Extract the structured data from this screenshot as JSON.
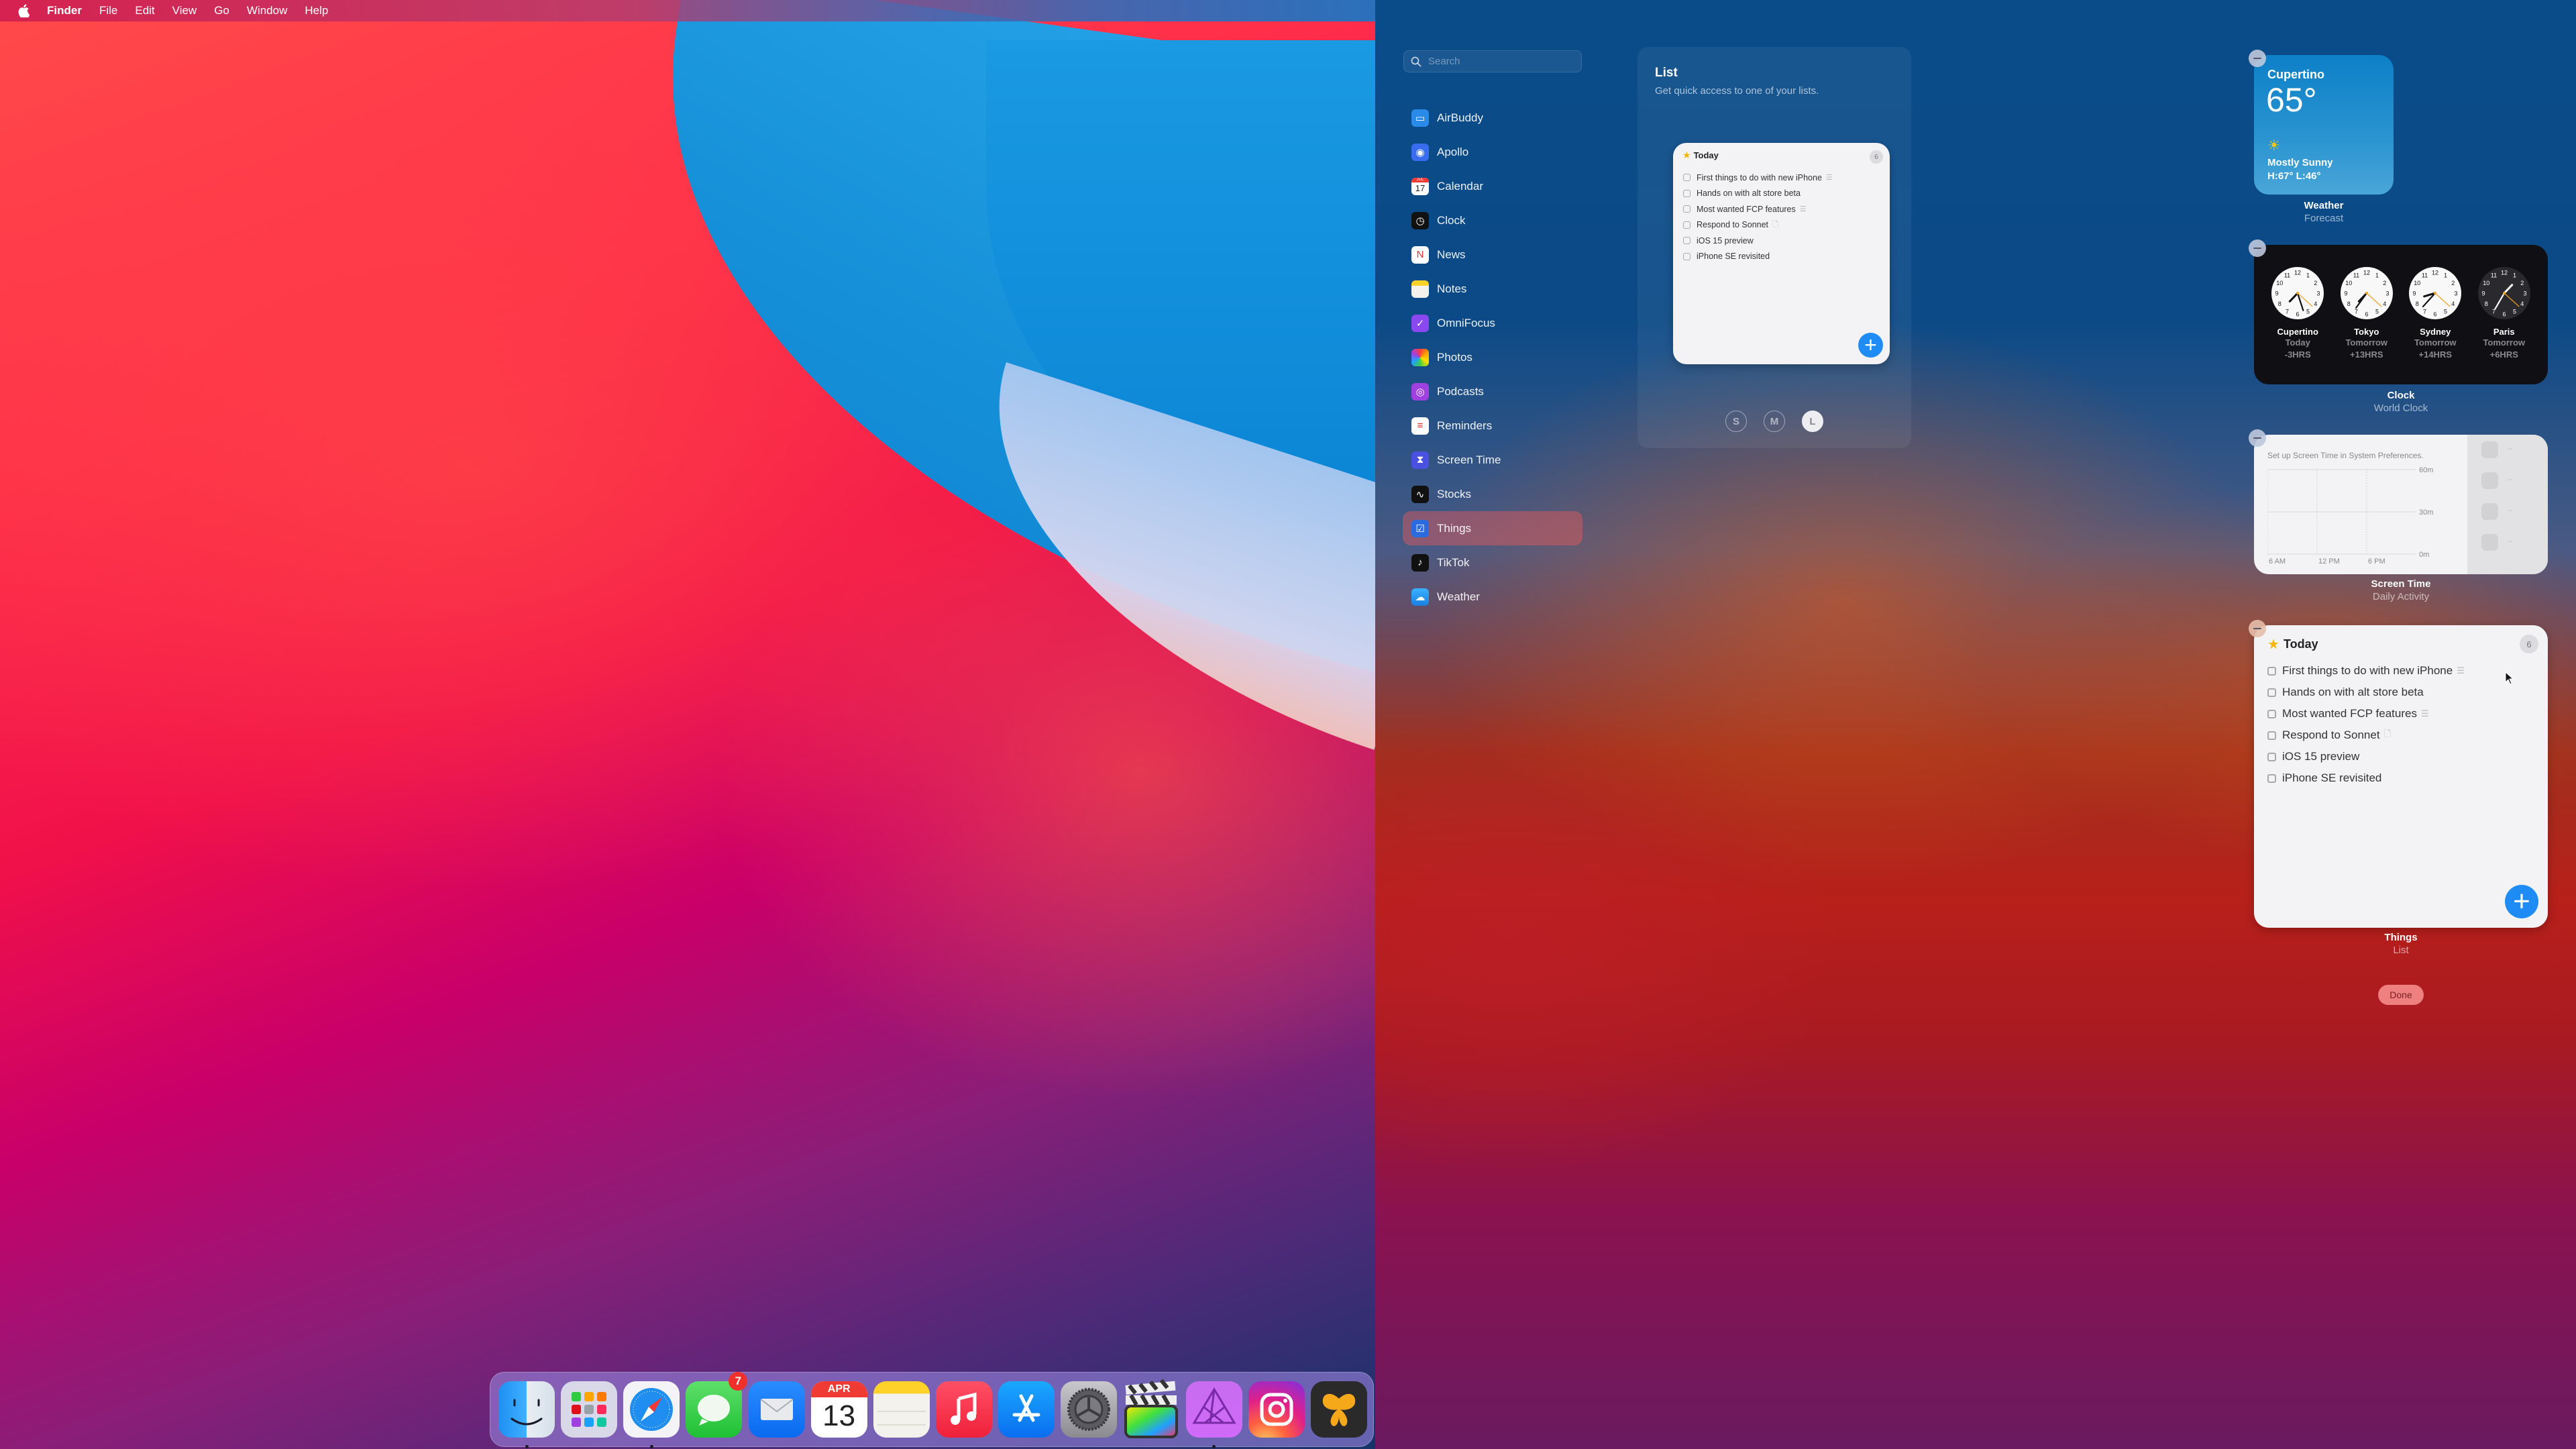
{
  "menubar": {
    "app_name": "Finder",
    "items": [
      "File",
      "Edit",
      "View",
      "Go",
      "Window",
      "Help"
    ]
  },
  "dock": {
    "items": [
      {
        "name": "Finder",
        "icon": "finder-icon",
        "running": true
      },
      {
        "name": "Launchpad",
        "icon": "launchpad-icon",
        "running": false
      },
      {
        "name": "Safari",
        "icon": "safari-icon",
        "running": true
      },
      {
        "name": "Messages",
        "icon": "messages-icon",
        "running": false,
        "badge": "7"
      },
      {
        "name": "Mail",
        "icon": "mail-icon",
        "running": false
      },
      {
        "name": "Calendar",
        "icon": "calendar-icon",
        "running": false,
        "month": "APR",
        "day": "13"
      },
      {
        "name": "Notes",
        "icon": "notes-icon",
        "running": false
      },
      {
        "name": "Music",
        "icon": "music-icon",
        "running": false
      },
      {
        "name": "App Store",
        "icon": "app-store-icon",
        "running": false
      },
      {
        "name": "System Preferences",
        "icon": "system-preferences-icon",
        "running": false
      },
      {
        "name": "Final Cut Pro",
        "icon": "final-cut-pro-icon",
        "running": false
      },
      {
        "name": "Affinity Photo",
        "icon": "affinity-photo-icon",
        "running": true
      },
      {
        "name": "Instagram",
        "icon": "instagram-icon",
        "running": false
      },
      {
        "name": "Ulysses",
        "icon": "ulysses-icon",
        "running": false
      }
    ]
  },
  "editor": {
    "search_placeholder": "Search",
    "apps": [
      {
        "label": "AirBuddy",
        "icon": "airbuddy-icon",
        "color": "#2a8ae8"
      },
      {
        "label": "Apollo",
        "icon": "apollo-icon",
        "color": "#3a6cf0"
      },
      {
        "label": "Calendar",
        "icon": "calendar-icon",
        "color": "#ffffff",
        "date": "17",
        "month": "JUL"
      },
      {
        "label": "Clock",
        "icon": "clock-icon",
        "color": "#111111"
      },
      {
        "label": "News",
        "icon": "news-icon",
        "color": "#ffffff"
      },
      {
        "label": "Notes",
        "icon": "notes-icon",
        "color": "#f4f2ec"
      },
      {
        "label": "OmniFocus",
        "icon": "omnifocus-icon",
        "color": "#8a48f0"
      },
      {
        "label": "Photos",
        "icon": "photos-icon",
        "color": "#ffffff"
      },
      {
        "label": "Podcasts",
        "icon": "podcasts-icon",
        "color": "#a040e0"
      },
      {
        "label": "Reminders",
        "icon": "reminders-icon",
        "color": "#ffffff"
      },
      {
        "label": "Screen Time",
        "icon": "screen-time-icon",
        "color": "#4a50e0"
      },
      {
        "label": "Stocks",
        "icon": "stocks-icon",
        "color": "#111111"
      },
      {
        "label": "Things",
        "icon": "things-icon",
        "color": "#2a6ce0",
        "selected": true
      },
      {
        "label": "TikTok",
        "icon": "tiktok-icon",
        "color": "#111111"
      },
      {
        "label": "Weather",
        "icon": "weather-icon",
        "color": "#2a9ef0"
      }
    ],
    "detail": {
      "title": "List",
      "description": "Get quick access to one of your lists.",
      "sizes": [
        "S",
        "M",
        "L"
      ],
      "selected_size": "L"
    }
  },
  "things_list": {
    "title": "Today",
    "count": "6",
    "items": [
      {
        "text": "First things to do with new iPhone",
        "attachment": "checklist-icon"
      },
      {
        "text": "Hands on with alt store beta",
        "attachment": null
      },
      {
        "text": "Most wanted FCP features",
        "attachment": "checklist-icon"
      },
      {
        "text": "Respond to Sonnet",
        "attachment": "note-icon"
      },
      {
        "text": "iOS 15 preview",
        "attachment": null
      },
      {
        "text": "iPhone SE revisited",
        "attachment": null
      }
    ],
    "add_label": "+"
  },
  "widgets": {
    "weather": {
      "city": "Cupertino",
      "temp": "65°",
      "condition": "Mostly Sunny",
      "high_low": "H:67° L:46°",
      "app": "Weather",
      "kind": "Forecast"
    },
    "clock": {
      "app": "Clock",
      "kind": "World Clock",
      "cities": [
        {
          "city": "Cupertino",
          "day": "Today",
          "offset": "-3HRS",
          "dark": false,
          "hour": 7.45,
          "minute": 27,
          "second": 22
        },
        {
          "city": "Tokyo",
          "day": "Tomorrow",
          "offset": "+13HRS",
          "dark": false,
          "hour": 7.45,
          "minute": 36,
          "second": 22
        },
        {
          "city": "Sydney",
          "day": "Tomorrow",
          "offset": "+14HRS",
          "dark": false,
          "hour": 8.45,
          "minute": 37,
          "second": 22
        },
        {
          "city": "Paris",
          "day": "Tomorrow",
          "offset": "+6HRS",
          "dark": true,
          "hour": 1.45,
          "minute": 35,
          "second": 22
        }
      ]
    },
    "screen_time": {
      "app": "Screen Time",
      "kind": "Daily Activity",
      "message": "Set up Screen Time in System Preferences.",
      "placeholder": "--"
    },
    "things": {
      "app": "Things",
      "kind": "List"
    }
  },
  "done_label": "Done",
  "chart_data": {
    "type": "bar",
    "title": "Set up Screen Time in System Preferences.",
    "categories": [
      "6 AM",
      "12 PM",
      "6 PM"
    ],
    "values": [],
    "yticks": [
      "0m",
      "30m",
      "60m"
    ],
    "ylim": [
      0,
      60
    ],
    "grid": true
  }
}
